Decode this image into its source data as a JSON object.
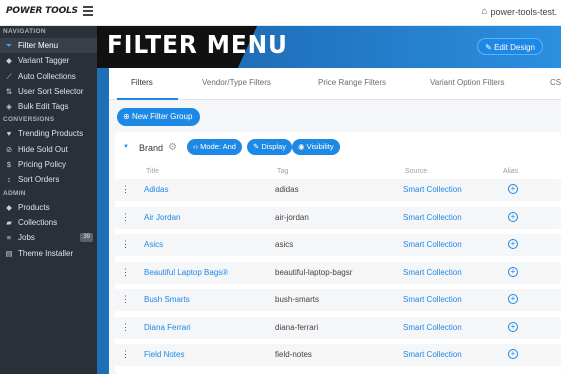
{
  "header": {
    "logo": "POWER TOOLS",
    "site": "power-tools-test."
  },
  "banner": {
    "title": "FILTER MENU",
    "edit_button": "Edit Design"
  },
  "sidebar": {
    "sections": [
      {
        "title": "NAVIGATION",
        "items": [
          {
            "label": "Filter Menu",
            "icon": "filter-icon",
            "active": true
          },
          {
            "label": "Variant Tagger",
            "icon": "tag-icon"
          },
          {
            "label": "Auto Collections",
            "icon": "magic-wand-icon"
          },
          {
            "label": "User Sort Selector",
            "icon": "sort-icon"
          },
          {
            "label": "Bulk Edit Tags",
            "icon": "tags-icon"
          }
        ]
      },
      {
        "title": "CONVERSIONS",
        "items": [
          {
            "label": "Trending Products",
            "icon": "heart-icon"
          },
          {
            "label": "Hide Sold Out",
            "icon": "eye-slash-icon"
          },
          {
            "label": "Pricing Policy",
            "icon": "dollar-icon"
          },
          {
            "label": "Sort Orders",
            "icon": "sort-arrows-icon"
          }
        ]
      },
      {
        "title": "ADMIN",
        "items": [
          {
            "label": "Products",
            "icon": "tag-icon"
          },
          {
            "label": "Collections",
            "icon": "folder-icon"
          },
          {
            "label": "Jobs",
            "icon": "list-icon",
            "badge": "39"
          },
          {
            "label": "Theme Installer",
            "icon": "file-icon"
          }
        ]
      }
    ]
  },
  "tabs": [
    {
      "label": "Filters",
      "active": true
    },
    {
      "label": "Vendor/Type Filters"
    },
    {
      "label": "Price Range Filters"
    },
    {
      "label": "Variant Option Filters"
    },
    {
      "label": "CS"
    }
  ],
  "new_group_button": "New Filter Group",
  "group": {
    "name": "Brand",
    "mode_button": "Mode: And",
    "display_button": "Display",
    "visibility_button": "Visibility",
    "columns": [
      "Title",
      "Tag",
      "Source",
      "Alias"
    ],
    "rows": [
      {
        "title": "Adidas",
        "tag": "adidas",
        "source": "Smart Collection"
      },
      {
        "title": "Air Jordan",
        "tag": "air-jordan",
        "source": "Smart Collection"
      },
      {
        "title": "Asics",
        "tag": "asics",
        "source": "Smart Collection"
      },
      {
        "title": "Beautiful Laptop Bags®",
        "tag": "beautiful-laptop-bagsr",
        "source": "Smart Collection"
      },
      {
        "title": "Bush Smarts",
        "tag": "bush-smarts",
        "source": "Smart Collection"
      },
      {
        "title": "Diana Ferrari",
        "tag": "diana-ferrari",
        "source": "Smart Collection"
      },
      {
        "title": "Field Notes",
        "tag": "field-notes",
        "source": "Smart Collection"
      }
    ]
  },
  "colors": {
    "accent": "#1e88e5",
    "sidebar_bg": "#2b3038",
    "banner_black": "#111111"
  }
}
